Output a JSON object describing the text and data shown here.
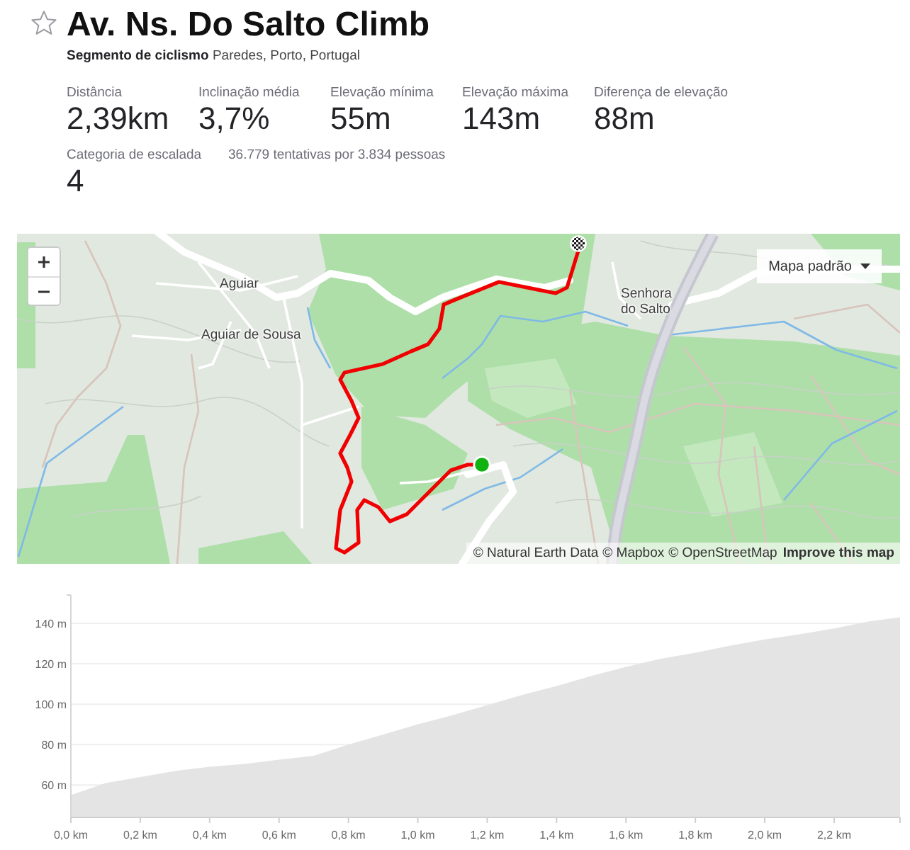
{
  "segment": {
    "starred": false,
    "title": "Av. Ns. Do Salto Climb",
    "subtitle": "**Segmento de ciclismo** Paredes, Porto, Portugal"
  },
  "stats": [
    {
      "label": "Distância",
      "value": "2,39km"
    },
    {
      "label": "Inclinação média",
      "value": "3,7%"
    },
    {
      "label": "Elevação mínima",
      "value": "55m"
    },
    {
      "label": "Elevação máxima",
      "value": "143m"
    },
    {
      "label": "Diferença de elevação",
      "value": "88m"
    }
  ],
  "climb_category": {
    "label": "Categoria de escalada",
    "value": "4"
  },
  "attempts": "36.779 tentativas por 3.834 pessoas",
  "map": {
    "style_menu": "Mapa padrão",
    "places": [
      "Aguiar",
      "Aguiar de Sousa",
      "Senhora do Salto"
    ],
    "attribution": [
      "© Natural Earth Data",
      "© Mapbox",
      "© OpenStreetMap"
    ],
    "improve_link": "Improve this map"
  },
  "elevation_profile": {
    "chart_data": {
      "type": "area",
      "grid": true,
      "x": [
        0,
        0.1,
        0.2,
        0.3,
        0.4,
        0.5,
        0.6,
        0.7,
        0.8,
        0.9,
        1.0,
        1.1,
        1.2,
        1.3,
        1.4,
        1.5,
        1.6,
        1.7,
        1.8,
        1.9,
        2.0,
        2.1,
        2.2,
        2.3,
        2.39
      ],
      "series": [
        {
          "color": "#e4e4e4",
          "values": [
            55,
            61,
            64,
            67,
            69,
            70.5,
            72.5,
            74.5,
            80,
            85,
            90,
            94.5,
            99.5,
            104.5,
            109,
            114,
            118.5,
            122.5,
            125.5,
            129,
            132,
            134.5,
            137.5,
            141,
            143
          ]
        }
      ],
      "xlim": [
        0,
        2.39
      ],
      "ylim": [
        44,
        154
      ],
      "xticks": [
        {
          "value": 0,
          "label": "0,0 km"
        },
        {
          "value": 0.2,
          "label": "0,2 km"
        },
        {
          "value": 0.4,
          "label": "0,4 km"
        },
        {
          "value": 0.6,
          "label": "0,6 km"
        },
        {
          "value": 0.8,
          "label": "0,8 km"
        },
        {
          "value": 1.0,
          "label": "1,0 km"
        },
        {
          "value": 1.2,
          "label": "1,2 km"
        },
        {
          "value": 1.4,
          "label": "1,4 km"
        },
        {
          "value": 1.6,
          "label": "1,6 km"
        },
        {
          "value": 1.8,
          "label": "1,8 km"
        },
        {
          "value": 2.0,
          "label": "2,0 km"
        },
        {
          "value": 2.2,
          "label": "2,2 km"
        }
      ],
      "yticks": [
        {
          "value": 60,
          "label": "60 m"
        },
        {
          "value": 80,
          "label": "80 m"
        },
        {
          "value": 100,
          "label": "100 m"
        },
        {
          "value": 120,
          "label": "120 m"
        },
        {
          "value": 140,
          "label": "140 m"
        }
      ]
    }
  }
}
